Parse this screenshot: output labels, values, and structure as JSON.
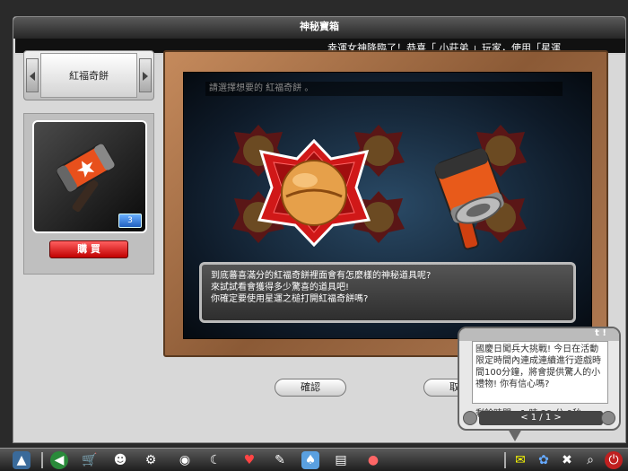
{
  "window": {
    "title": "神秘寶箱",
    "marquee": "幸運女神降臨了！恭喜「 小莊弟 」玩家，使用「星運"
  },
  "category": {
    "name": "紅福奇餅"
  },
  "item": {
    "quantity": "3",
    "buy_label": "購 買"
  },
  "scene": {
    "hint": "請選擇想要的 紅福奇餅 。"
  },
  "dialog": {
    "lines": [
      "到底蕃喜滿分的紅福奇餅裡面會有怎麼樣的神秘道具呢?",
      "來試試看會獲得多少驚喜的道具吧!",
      "你確定要使用星運之槌打開紅福奇餅嗎?"
    ],
    "confirm_label": "確認",
    "cancel_label": "取消"
  },
  "popup": {
    "header": "t !",
    "text": "國慶日闖兵大挑戰! 今日在活動限定時間內連成連續進行遊戲時間100分鐘，將會提供驚人的小禮物! 你有信心嗎?",
    "timer": "剩餘時間 - 1 時 39 分 9秒",
    "page": "< 1 / 1 >"
  },
  "colors": {
    "accent_red": "#c00000",
    "qty_blue": "#2060c0",
    "frame_wood": "#8b5a36"
  }
}
